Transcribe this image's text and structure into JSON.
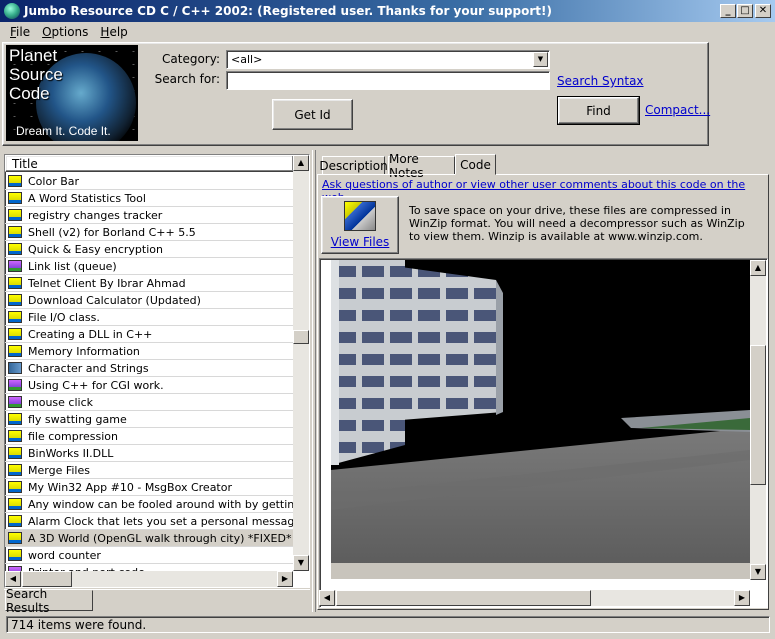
{
  "window": {
    "title": "Jumbo Resource CD C / C++ 2002: (Registered user.  Thanks for your support!)",
    "min": "_",
    "max": "□",
    "close": "✕"
  },
  "menu": [
    "File",
    "Options",
    "Help"
  ],
  "logo": {
    "line1": "Planet",
    "line2": "Source",
    "line3": "Code",
    "slogan": "Dream It.  Code It."
  },
  "search": {
    "category_label": "Category:",
    "category_value": "<all>",
    "search_label": "Search for:",
    "search_value": "",
    "syntax_link": "Search Syntax",
    "getid_label": "Get Id",
    "find_label": "Find",
    "compact_link": "Compact..."
  },
  "list": {
    "header": "Title",
    "items": [
      {
        "label": "Color Bar",
        "icon": "file-icon"
      },
      {
        "label": "A Word Statistics Tool",
        "icon": "file-icon"
      },
      {
        "label": "registry changes tracker",
        "icon": "file-icon"
      },
      {
        "label": "Shell (v2) for Borland C++ 5.5",
        "icon": "file-icon"
      },
      {
        "label": "Quick & Easy encryption",
        "icon": "file-icon"
      },
      {
        "label": "Link list (queue)",
        "icon": "tree-icon"
      },
      {
        "label": "Telnet Client By Ibrar Ahmad",
        "icon": "file-icon"
      },
      {
        "label": "Download Calculator (Updated)",
        "icon": "file-icon"
      },
      {
        "label": "File I/O class.",
        "icon": "file-icon"
      },
      {
        "label": "Creating a DLL in C++",
        "icon": "file-icon"
      },
      {
        "label": "Memory Information",
        "icon": "file-icon"
      },
      {
        "label": "Character and Strings",
        "icon": "book-icon"
      },
      {
        "label": "Using C++ for CGI work.",
        "icon": "tree-icon"
      },
      {
        "label": "mouse click",
        "icon": "tree-icon"
      },
      {
        "label": "fly swatting game",
        "icon": "file-icon"
      },
      {
        "label": "file compression",
        "icon": "file-icon"
      },
      {
        "label": "BinWorks II.DLL",
        "icon": "file-icon"
      },
      {
        "label": "Merge Files",
        "icon": "file-icon"
      },
      {
        "label": "My Win32 App #10 - MsgBox Creator",
        "icon": "file-icon"
      },
      {
        "label": "Any window can be fooled around with by getting it's har",
        "icon": "file-icon"
      },
      {
        "label": "Alarm Clock that lets you set a personal message!",
        "icon": "file-icon"
      },
      {
        "label": "A 3D World (OpenGL walk through city) *FIXED*",
        "icon": "file-icon",
        "selected": true
      },
      {
        "label": "word counter",
        "icon": "file-icon"
      },
      {
        "label": "Printer and port code",
        "icon": "tree-icon"
      }
    ],
    "bottom_tab": "Search Results"
  },
  "detail": {
    "tabs": [
      "Description",
      "More Notes",
      "Code"
    ],
    "active_tab": "Code",
    "ask_link": "Ask questions of author or view other user comments about this code on the web...",
    "view_files_label": "View Files",
    "zip_note": "To save space on your drive, these files are compressed in WinZip format.  You will need a decompressor such as WinZip to view them.  Winzip is available at www.winzip.com."
  },
  "status": {
    "text": "714 items were found."
  }
}
